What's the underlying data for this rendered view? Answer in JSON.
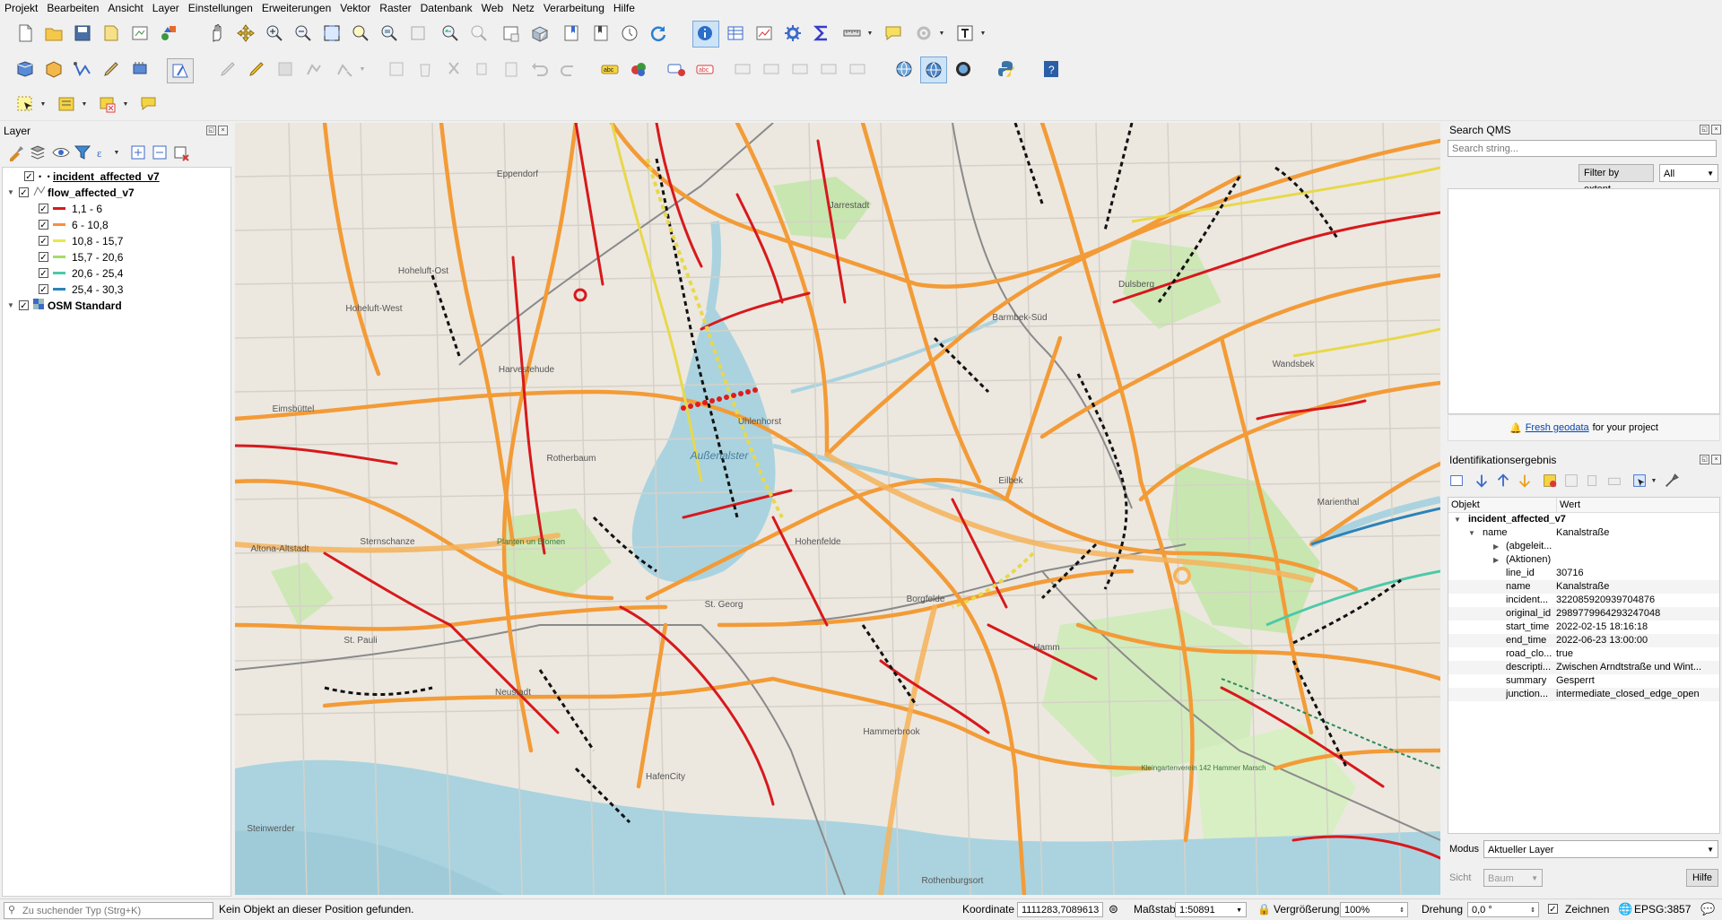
{
  "menu": [
    "Projekt",
    "Bearbeiten",
    "Ansicht",
    "Layer",
    "Einstellungen",
    "Erweiterungen",
    "Vektor",
    "Raster",
    "Datenbank",
    "Web",
    "Netz",
    "Verarbeitung",
    "Hilfe"
  ],
  "layers_panel": {
    "title": "Layer",
    "layers": [
      {
        "name": "incident_affected_v7",
        "checked": "✓"
      },
      {
        "name": "flow_affected_v7",
        "checked": "✓"
      },
      {
        "name": "OSM Standard",
        "checked": "✓"
      }
    ],
    "legend": [
      {
        "label": "1,1 - 6",
        "color": "#d7191c",
        "checked": "✓"
      },
      {
        "label": "6 - 10,8",
        "color": "#fd8d3c",
        "checked": "✓"
      },
      {
        "label": "10,8 - 15,7",
        "color": "#e8e84a",
        "checked": "✓"
      },
      {
        "label": "15,7 - 20,6",
        "color": "#a6d96a",
        "checked": "✓"
      },
      {
        "label": "20,6 - 25,4",
        "color": "#4cc9a8",
        "checked": "✓"
      },
      {
        "label": "25,4 - 30,3",
        "color": "#2b83ba",
        "checked": "✓"
      }
    ]
  },
  "qms": {
    "title": "Search QMS",
    "search_placeholder": "Search string...",
    "filter_button": "Filter by extent",
    "filter_select": "All",
    "promo_link": "Fresh geodata",
    "promo_text": "for your project"
  },
  "identify": {
    "title": "Identifikationsergebnis",
    "col_object": "Objekt",
    "col_value": "Wert",
    "layer": "incident_affected_v7",
    "feature_key": "name",
    "feature_value": "Kanalstraße",
    "derived": "(abgeleit...",
    "actions": "(Aktionen)",
    "attributes": [
      {
        "key": "line_id",
        "value": "30716"
      },
      {
        "key": "name",
        "value": "Kanalstraße"
      },
      {
        "key": "incident...",
        "value": "322085920939704876"
      },
      {
        "key": "original_id",
        "value": "2989779964293247048"
      },
      {
        "key": "start_time",
        "value": "2022-02-15 18:16:18"
      },
      {
        "key": "end_time",
        "value": "2022-06-23 13:00:00"
      },
      {
        "key": "road_clo...",
        "value": "true"
      },
      {
        "key": "descripti...",
        "value": "Zwischen Arndtstraße und Wint..."
      },
      {
        "key": "summary",
        "value": "Gesperrt"
      },
      {
        "key": "junction...",
        "value": "intermediate_closed_edge_open"
      }
    ],
    "mode_label": "Modus",
    "mode_value": "Aktueller Layer",
    "view_label": "Sicht",
    "view_value": "Baum",
    "help_button": "Hilfe"
  },
  "map_labels": {
    "uhlenhorst": "Uhlenhorst",
    "aussenalster": "Außenalster",
    "rotherbaum": "Rotherbaum",
    "harvestehude": "Harvestehude",
    "hoheluft_ost": "Hoheluft-Ost",
    "hoheluft_west": "Hoheluft-West",
    "eimsbuettel": "Eimsbüttel",
    "sternschanze": "Sternschanze",
    "st_pauli": "St. Pauli",
    "st_georg": "St. Georg",
    "neustadt": "Neustadt",
    "hafencity": "HafenCity",
    "hohenfelde": "Hohenfelde",
    "eilbek": "Eilbek",
    "barmbek_sued": "Barmbek-Süd",
    "dulsberg": "Dulsberg",
    "wandsbek": "Wandsbek",
    "marienthal": "Marienthal",
    "hamm": "Hamm",
    "borgfelde": "Borgfelde",
    "hammerbrook": "Hammerbrook",
    "rothenburgsort": "Rothenburgsort",
    "steinwerder": "Steinwerder",
    "eppendorf": "Eppendorf",
    "winterhude": "Jarrestadt",
    "kleingartenverein": "Kleingartenverein 142 Hammer Marsch",
    "planten": "Planten un Blomen",
    "altona": "Altona-Altstadt"
  },
  "status": {
    "search_placeholder": "Zu suchender Typ (Strg+K)",
    "message": "Kein Objekt an dieser Position gefunden.",
    "coord_label": "Koordinate",
    "coord_value": "1111283,7089613",
    "scale_label": "Maßstab",
    "scale_value": "1:50891",
    "magnifier_label": "Vergrößerung",
    "magnifier_value": "100%",
    "rotation_label": "Drehung",
    "rotation_value": "0,0 °",
    "render_label": "Zeichnen",
    "crs": "EPSG:3857"
  }
}
